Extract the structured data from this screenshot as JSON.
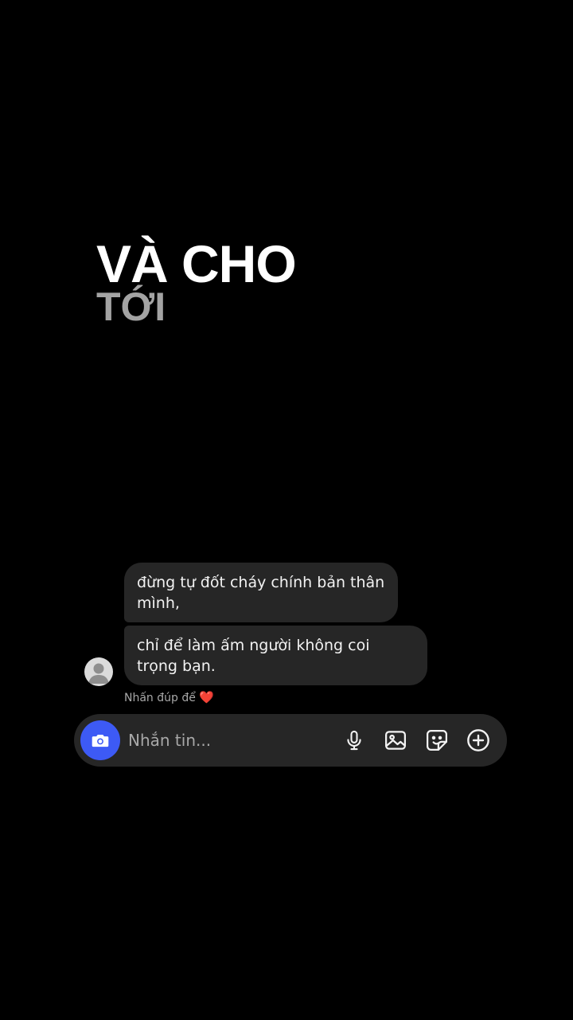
{
  "overlay": {
    "line1": "VÀ CHO",
    "line2": "TỚI"
  },
  "messages": [
    {
      "text": "đừng tự đốt cháy chính bản thân mình,"
    },
    {
      "text": "chỉ để làm ấm người không coi trọng bạn."
    }
  ],
  "hint": {
    "text": "Nhấn đúp để",
    "emoji": "❤️"
  },
  "composer": {
    "placeholder": "Nhắn tin...",
    "accent_color": "#3d5af5"
  },
  "icons": {
    "camera": "camera-icon",
    "mic": "microphone-icon",
    "gallery": "image-icon",
    "sticker": "sticker-icon",
    "plus": "plus-circle-icon",
    "avatar": "default-avatar-icon"
  }
}
